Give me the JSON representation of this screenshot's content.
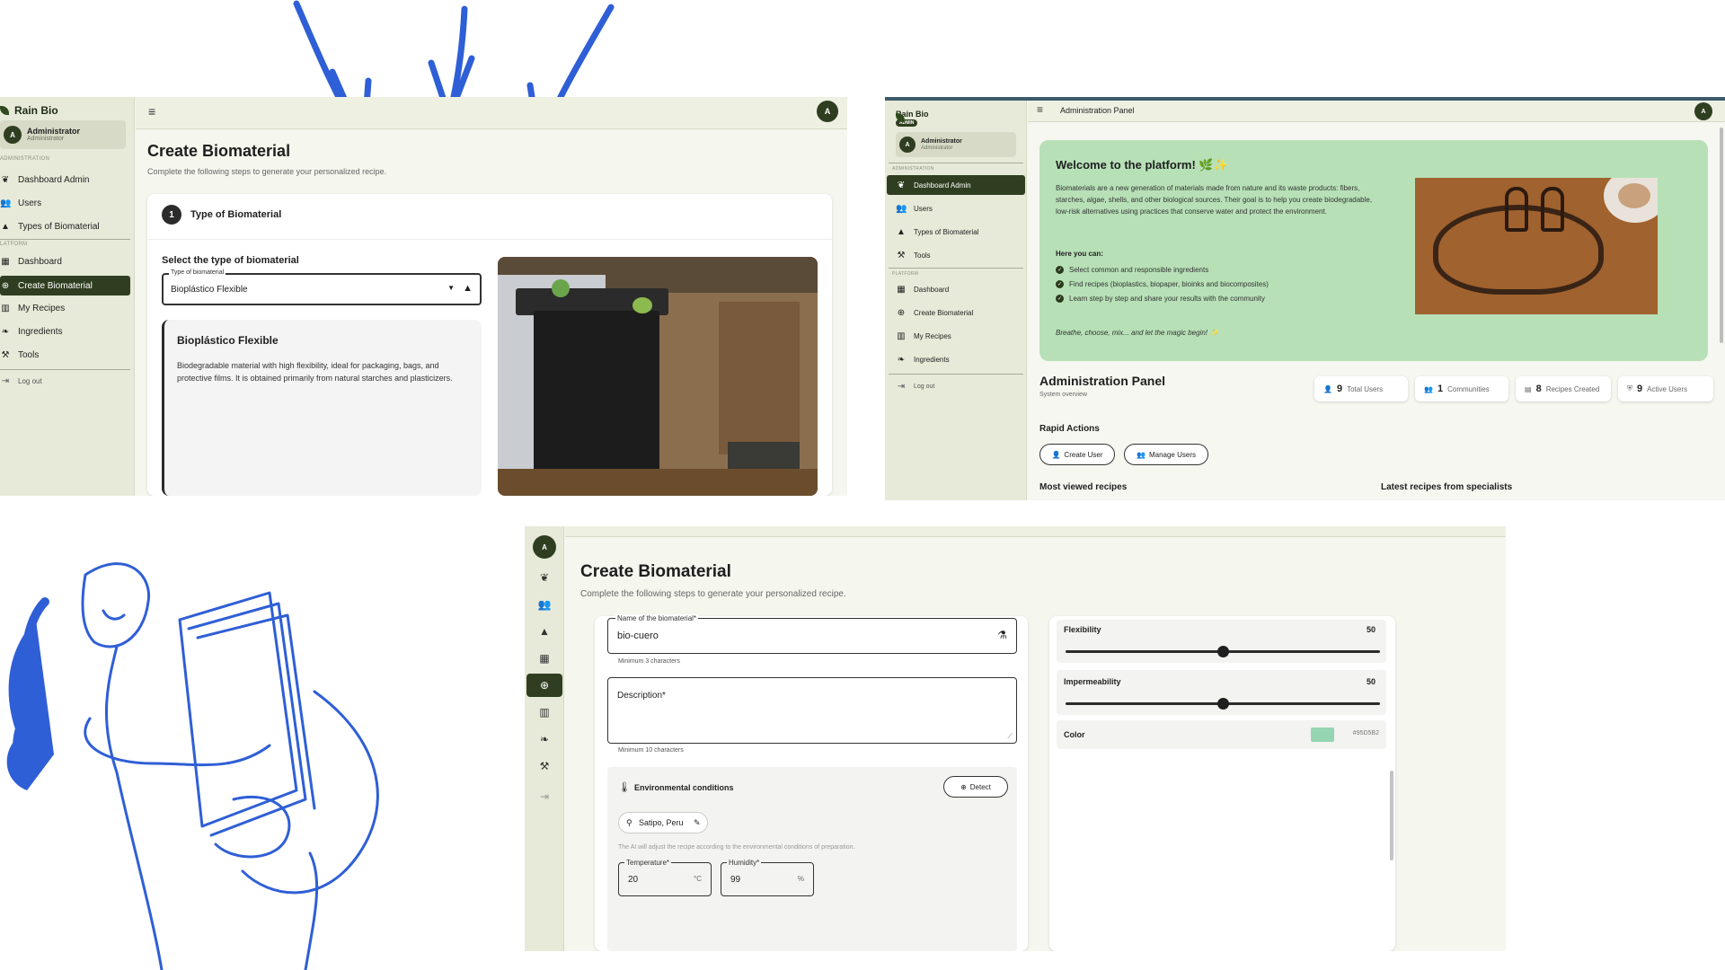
{
  "app": {
    "brand": "Rain Bio"
  },
  "user": {
    "initial": "A",
    "name": "Administrator",
    "role": "Administrator",
    "badge": "ADMIN"
  },
  "colors": {
    "primary": "#2f3e20",
    "sidebar": "#e7ead8",
    "welcome": "#b7e0b7",
    "arrow": "#2f5fd6"
  },
  "nav": {
    "section_admin": "ADMINISTRATION",
    "section_platform": "PLATFORM",
    "section_platform_cut": "LATFORM",
    "items": [
      {
        "label": "Dashboard Admin",
        "icon": "eco-icon"
      },
      {
        "label": "Users",
        "icon": "users-icon"
      },
      {
        "label": "Types of Biomaterial",
        "icon": "category-icon"
      },
      {
        "label": "Dashboard",
        "icon": "dashboard-icon"
      },
      {
        "label": "Create Biomaterial",
        "icon": "add-circle-icon"
      },
      {
        "label": "My Recipes",
        "icon": "book-icon"
      },
      {
        "label": "Ingredients",
        "icon": "leaf-icon"
      },
      {
        "label": "Tools",
        "icon": "tools-icon"
      }
    ],
    "logout": "Log out"
  },
  "create": {
    "title": "Create Biomaterial",
    "subtitle": "Complete the following steps to generate your personalized recipe.",
    "step_number": "1",
    "step_title": "Type of Biomaterial",
    "select_heading": "Select the type of biomaterial",
    "select_label": "Type of biomaterial",
    "select_value": "Bioplástico Flexible",
    "info_title": "Bioplástico Flexible",
    "info_text": "Biodegradable material with high flexibility, ideal for packaging, bags, and protective films. It is obtained primarily from natural starches and plasticizers."
  },
  "admin": {
    "topbar_title": "Administration Panel",
    "welcome_title": "Welcome to the platform! 🌿✨",
    "welcome_text": "Biomaterials are a new generation of materials made from nature and its waste products: fibers, starches, algae, shells, and other biological sources. Their goal is to help you create biodegradable, low-risk alternatives using practices that conserve water and protect the environment.",
    "can_heading": "Here you can:",
    "can_items": [
      "Select common and responsible ingredients",
      "Find recipes (bioplastics, biopaper, bioinks and biocomposites)",
      "Learn step by step and share your results with the community"
    ],
    "tagline": "Breathe, choose, mix... and let the magic begin! ✨",
    "panel_title": "Administration Panel",
    "panel_sub": "System overview",
    "stats": [
      {
        "value": "9",
        "label": "Total Users"
      },
      {
        "value": "1",
        "label": "Communities"
      },
      {
        "value": "8",
        "label": "Recipes Created"
      },
      {
        "value": "9",
        "label": "Active Users"
      }
    ],
    "rapid_title": "Rapid Actions",
    "create_user": "Create User",
    "manage_users": "Manage Users",
    "most_viewed": "Most viewed recipes",
    "latest": "Latest recipes from specialists"
  },
  "form": {
    "name_label": "Name of the biomaterial*",
    "name_value": "bio-cuero",
    "name_hint": "Minimum 3 characters",
    "desc_label": "Description*",
    "desc_hint": "Minimum 10 characters",
    "env_title": "Environmental conditions",
    "detect": "Detect",
    "location": "Satipo, Peru",
    "ai_note": "The AI will adjust the recipe according to the environmental conditions of preparation.",
    "temp_label": "Temperature*",
    "temp_value": "20",
    "temp_unit": "°C",
    "hum_label": "Humidity*",
    "hum_value": "99",
    "hum_unit": "%",
    "flex_label": "Flexibility",
    "flex_value": "50",
    "flex_fraction": 0.5,
    "imp_label": "Impermeability",
    "imp_value": "50",
    "imp_fraction": 0.5,
    "color_label": "Color",
    "color_hex": "#95D5B2"
  }
}
